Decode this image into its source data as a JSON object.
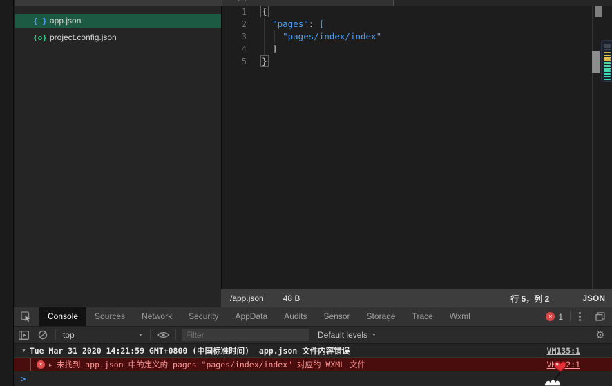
{
  "colors": {
    "accent_blue": "#4f9ff8",
    "accent_green": "#2fc98c",
    "selection_green": "#1d5a43",
    "error_red": "#e04b4b",
    "error_row_bg": "#4a0d0d"
  },
  "top_strip": {
    "overflow_hint": "···"
  },
  "sidebar": {
    "files": [
      {
        "icon": "{ }",
        "name": "app.json"
      },
      {
        "icon": "{o}",
        "name": "project.config.json"
      }
    ]
  },
  "editor": {
    "line_numbers": [
      "1",
      "2",
      "3",
      "4",
      "5"
    ],
    "tokens": {
      "open_brace": "{",
      "l2_indent": "  ",
      "l2_key": "\"pages\"",
      "l2_colon": ": ",
      "l2_bracket": "[",
      "l3_indent": "    ",
      "l3_string": "\"pages/index/index\"",
      "l4_text": "  ]",
      "close_brace": "}"
    }
  },
  "status_bar": {
    "file_path": "/app.json",
    "file_size": "48 B",
    "cursor_position": "行 5，列 2",
    "language": "JSON"
  },
  "devtools": {
    "tabs": [
      {
        "label": "Console"
      },
      {
        "label": "Sources"
      },
      {
        "label": "Network"
      },
      {
        "label": "Security"
      },
      {
        "label": "AppData"
      },
      {
        "label": "Audits"
      },
      {
        "label": "Sensor"
      },
      {
        "label": "Storage"
      },
      {
        "label": "Trace"
      },
      {
        "label": "Wxml"
      }
    ],
    "error_badge_count": "1",
    "toolbar": {
      "context_selector": "top",
      "filter_placeholder": "Filter",
      "log_level": "Default levels"
    },
    "console": {
      "group_row": {
        "collapse_glyph": "▼",
        "message": "Tue Mar 31 2020 14:21:59 GMT+0800 (中国标准时间)  app.json 文件内容错误",
        "source_link": "VM135:1"
      },
      "error_row": {
        "expand_glyph": "▶",
        "error_x": "×",
        "message": "未找到 app.json 中的定义的 pages \"pages/index/index\" 对应的 WXML 文件",
        "source_link": "VM122:1"
      },
      "prompt_glyph": ">"
    }
  },
  "level_widget": {
    "stripe_colors": [
      "#41464f",
      "#41464f",
      "#41464f",
      "#c9a946",
      "#e0bd4e",
      "#e2c24f",
      "#d9b44a",
      "#52cf9f",
      "#4bd4a6",
      "#44d7ab",
      "#3edab0",
      "#38dcb4",
      "#33deb8",
      "#2fe0bb"
    ]
  },
  "glyphs": {
    "dropdown_arrow": "▼",
    "gear": "⚙"
  }
}
